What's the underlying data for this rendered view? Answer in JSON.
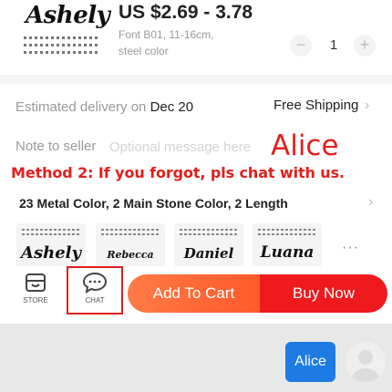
{
  "product": {
    "thumb_text": "Ashely",
    "price": "US $2.69 - 3.78",
    "variant_font": "Font B01, 11-16cm,",
    "variant_color": "steel color",
    "quantity": "1",
    "minus": "−",
    "plus": "+"
  },
  "delivery": {
    "label": "Estimated delivery on",
    "date": "Dec 20",
    "shipping": "Free Shipping"
  },
  "note": {
    "label": "Note to seller",
    "placeholder": "Optional message here",
    "handwritten": "Alice"
  },
  "method_text": "Method 2: If you forgot, pls chat with us.",
  "options": {
    "title": "23 Metal Color, 2 Main Stone Color, 2 Length",
    "swatches": [
      "Ashely",
      "Rebecca",
      "Daniel",
      "Luana"
    ],
    "more": "···"
  },
  "actions": {
    "store": "STORE",
    "chat": "CHAT",
    "add_to_cart": "Add To Cart",
    "buy_now": "Buy Now"
  },
  "chat_preview": {
    "bubble": "Alice"
  },
  "colors": {
    "accent_red": "#e0201c",
    "cart_orange": "#ff6a3a",
    "buy_red": "#ee1a1d",
    "bubble_blue": "#1e7be3"
  },
  "icons": {
    "chevron": "chevron-right-icon",
    "store": "store-icon",
    "chat": "chat-icon",
    "avatar": "user-avatar-icon"
  }
}
